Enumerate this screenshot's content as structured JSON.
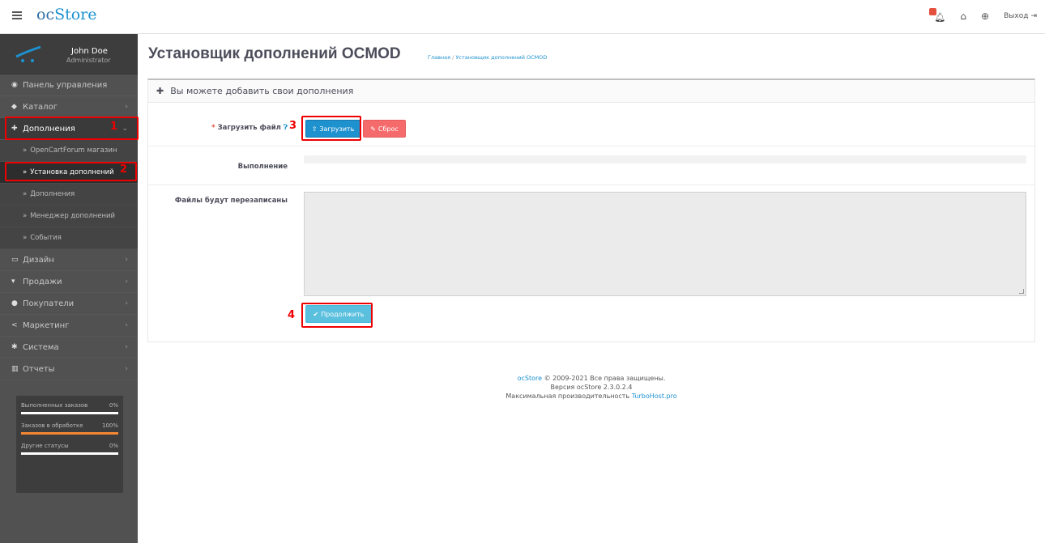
{
  "header": {
    "logo_oc": "oc",
    "logo_store": "Store",
    "notification_count": "",
    "logout_label": "Выход"
  },
  "profile": {
    "name": "John Doe",
    "role": "Administrator"
  },
  "sidebar": {
    "items": [
      {
        "label": "Панель управления",
        "icon": "dashboard-icon"
      },
      {
        "label": "Каталог",
        "icon": "tag-icon"
      },
      {
        "label": "Дополнения",
        "icon": "puzzle-icon"
      },
      {
        "label": "Дизайн",
        "icon": "monitor-icon"
      },
      {
        "label": "Продажи",
        "icon": "cart-icon"
      },
      {
        "label": "Покупатели",
        "icon": "user-icon"
      },
      {
        "label": "Маркетинг",
        "icon": "share-icon"
      },
      {
        "label": "Система",
        "icon": "gear-icon"
      },
      {
        "label": "Отчеты",
        "icon": "bar-chart-icon"
      }
    ],
    "subitems": [
      "OpenCartForum магазин",
      "Установка дополнений",
      "Дополнения",
      "Менеджер дополнений",
      "События"
    ],
    "stats": [
      {
        "label": "Выполненных заказов",
        "value": "0%",
        "fill": 0
      },
      {
        "label": "Заказов в обработке",
        "value": "100%",
        "fill": 100
      },
      {
        "label": "Другие статусы",
        "value": "0%",
        "fill": 0
      }
    ]
  },
  "annotations": {
    "n1": "1",
    "n2": "2",
    "n3": "3",
    "n4": "4"
  },
  "page": {
    "title": "Установщик дополнений OCMOD",
    "breadcrumb_home": "Главная",
    "breadcrumb_sep": "/",
    "breadcrumb_current": "Установщик дополнений OCMOD",
    "panel_title": "Вы можете добавить свои дополнения",
    "upload_label": "Загрузить файл",
    "upload_required": "*",
    "upload_button": "Загрузить",
    "reset_button": "Сброс",
    "progress_label": "Выполнение",
    "progress_value": 0,
    "overwrite_label": "Файлы будут перезаписаны",
    "overwrite_value": "",
    "continue_button": "Продолжить"
  },
  "footer": {
    "brand": "ocStore",
    "copyright": "© 2009-2021 Все права защищены.",
    "version": "Версия ocStore 2.3.0.2.4",
    "perf_prefix": "Максимальная производительность",
    "perf_link": "TurboHost.pro"
  }
}
